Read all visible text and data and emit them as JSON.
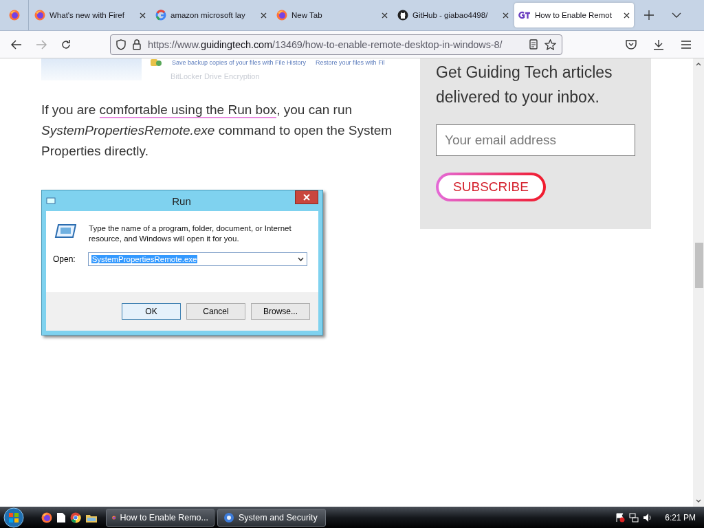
{
  "browser": {
    "tabs": [
      {
        "label": "What's new with Firef",
        "selected": false
      },
      {
        "label": "amazon microsoft lay",
        "selected": false
      },
      {
        "label": "New Tab",
        "selected": false
      },
      {
        "label": "GitHub - giabao4498/",
        "selected": false
      },
      {
        "label": "How to Enable Remot",
        "selected": true
      }
    ],
    "url": {
      "scheme": "https://www.",
      "host": "guidingtech.com",
      "path": "/13469/how-to-enable-remote-desktop-in-windows-8/"
    }
  },
  "article": {
    "image_snippet": {
      "links": [
        "Save backup copies of your files with File History",
        "Restore your files with Fil"
      ],
      "faded": "BitLocker Drive Encryption"
    },
    "paragraph": [
      {
        "kind": "text",
        "text": "If you are "
      },
      {
        "kind": "link",
        "text": "comfortable using the Run box"
      },
      {
        "kind": "text",
        "text": ", you can run *SystemPropertiesRemote.exe* command to open the System Properties directly."
      }
    ],
    "run_dialog": {
      "title": "Run",
      "description": "Type the name of a program, folder, document, or Internet resource, and Windows will open it for you.",
      "open_label": "Open:",
      "value": "SystemPropertiesRemote.exe",
      "buttons": [
        {
          "label": "OK",
          "default": true
        },
        {
          "label": "Cancel",
          "default": false
        },
        {
          "label": "Browse...",
          "default": false
        }
      ]
    }
  },
  "sidebar": {
    "heading": "Get Guiding Tech articles delivered to your inbox.",
    "email_placeholder": "Your email address",
    "subscribe": "SUBSCRIBE"
  },
  "taskbar": {
    "windows": [
      {
        "label": "How to Enable Remo..."
      },
      {
        "label": "System and Security"
      }
    ],
    "clock": "6:21 PM"
  }
}
